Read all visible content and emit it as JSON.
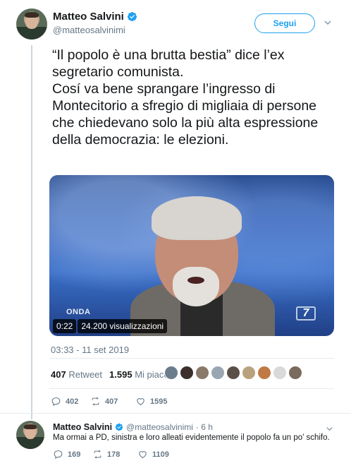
{
  "tweet": {
    "author_name": "Matteo Salvini",
    "author_handle": "@matteosalvinimi",
    "follow_label": "Segui",
    "text": "“Il popolo è una brutta bestia” dice l’ex segretario comunista.\nCosí va bene sprangare l’ingresso di Montecitorio a sfregio di migliaia di persone che chiedevano solo la più alta espressione della democrazia: le elezioni.",
    "video": {
      "duration": "0:22",
      "views": "24.200 visualizzazioni",
      "show_logo_text": "ONDA",
      "channel_logo_text": "7"
    },
    "timestamp": "03:33 - 11 set 2019",
    "retweets_count": "407",
    "retweets_label": "Retweet",
    "likes_count": "1.595",
    "likes_label": "Mi piace",
    "liker_avatar_colors": [
      "#6b7c8c",
      "#3a2f2a",
      "#8a7a6a",
      "#9aa6b1",
      "#5b5048",
      "#b8a27e",
      "#c07a46",
      "#d9d9d9",
      "#7a6a5e"
    ],
    "actions": {
      "replies": "402",
      "retweets": "407",
      "likes": "1595"
    }
  },
  "reply": {
    "author_name": "Matteo Salvini",
    "author_handle": "@matteosalvinimi",
    "time": "· 6 h",
    "text": "Ma ormai a PD, sinistra e loro alleati evidentemente il popolo fa un po’ schifo.",
    "actions": {
      "replies": "169",
      "retweets": "178",
      "likes": "1109"
    }
  },
  "colors": {
    "twitter_blue": "#1da1f2",
    "muted_text": "#657786",
    "divider": "#e6ecf0"
  }
}
